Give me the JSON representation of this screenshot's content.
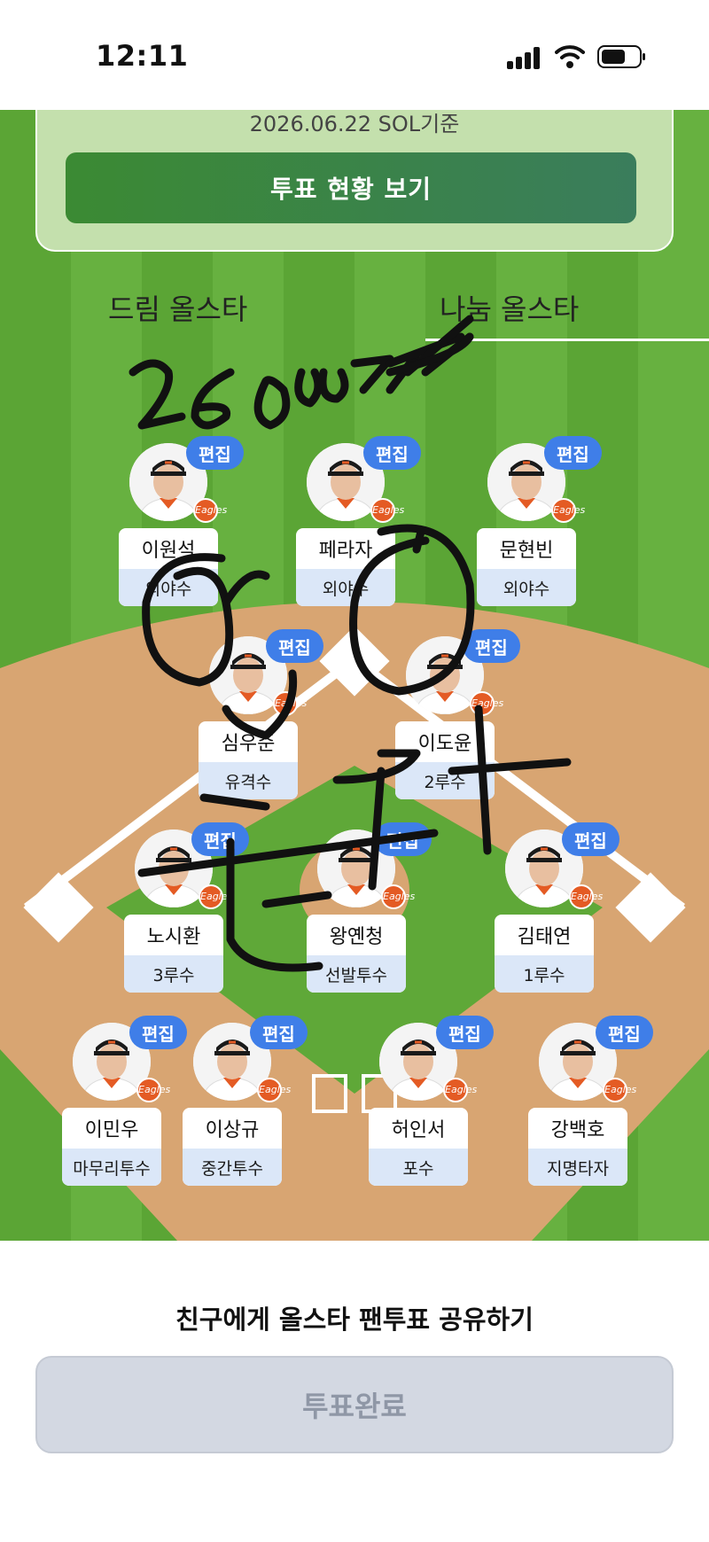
{
  "status_bar": {
    "time": "12:11"
  },
  "vote_card": {
    "date": "2026.06.22 SOL기준",
    "status_button": "투표 현황 보기"
  },
  "tabs": [
    {
      "label": "드림 올스타"
    },
    {
      "label": "나눔 올스타"
    }
  ],
  "edit_label": "편집",
  "team_logo": "Eagles",
  "players": [
    {
      "name": "이원석",
      "position": "외야수"
    },
    {
      "name": "페라자",
      "position": "외야수"
    },
    {
      "name": "문현빈",
      "position": "외야수"
    },
    {
      "name": "심우준",
      "position": "유격수"
    },
    {
      "name": "이도윤",
      "position": "2루수"
    },
    {
      "name": "노시환",
      "position": "3루수"
    },
    {
      "name": "왕옌청",
      "position": "선발투수"
    },
    {
      "name": "김태연",
      "position": "1루수"
    },
    {
      "name": "이민우",
      "position": "마무리투수"
    },
    {
      "name": "이상규",
      "position": "중간투수"
    },
    {
      "name": "허인서",
      "position": "포수"
    },
    {
      "name": "강백호",
      "position": "지명타자"
    }
  ],
  "share_link": "친구에게 올스타 팬투표 공유하기",
  "vote_done_button": "투표완료",
  "colors": {
    "accent_blue": "#3f7ee8",
    "field_green": "#5fa838",
    "vote_button_green": "#3b8a33"
  }
}
